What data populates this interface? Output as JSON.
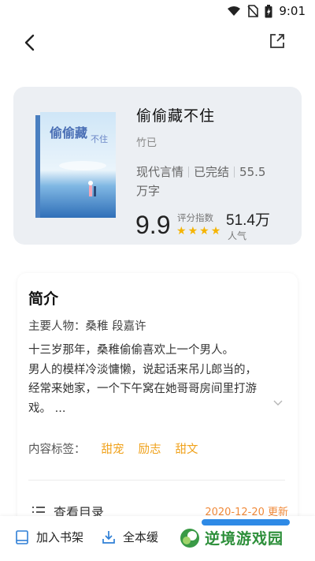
{
  "status_bar": {
    "time": "9:01",
    "icons": [
      "wifi-icon",
      "no-sim-icon",
      "battery-icon"
    ]
  },
  "top_bar": {
    "back_icon": "back-arrow-icon",
    "share_icon": "share-icon"
  },
  "book": {
    "title": "偷偷藏不住",
    "author": "竹已",
    "genre": "现代言情",
    "status": "已完结",
    "word_count_num": "55.5",
    "word_count_unit": "万字",
    "score": "9.9",
    "score_label": "评分指数",
    "stars": 4,
    "popularity": "51.4万",
    "popularity_unit": "万",
    "popularity_num": "51.4",
    "popularity_label": "人气",
    "cover_text": "偷偷藏不住"
  },
  "intro": {
    "title": "简介",
    "characters": "主要人物：桑稚 段嘉许",
    "synopsis_lines": [
      "十三岁那年，桑稚偷偷喜欢上一个男人。",
      "男人的模样冷淡慵懒，说起话来吊儿郎当的，",
      "经常来她家，一个下午窝在她哥哥房间里打游",
      "戏。 ..."
    ],
    "tags_label": "内容标签：",
    "tags": [
      "甜宠",
      "励志",
      "甜文"
    ],
    "catalog_label": "查看目录",
    "catalog_update": "2020-12-20 更新"
  },
  "bottom_bar": {
    "add_shelf": "加入书架",
    "download_all": "全本缓",
    "watermark": "逆境游戏园"
  },
  "colors": {
    "accent_orange": "#f0a21c",
    "star": "#f5b400",
    "card_bg": "#eceff3",
    "read_button": "#2e8ae6",
    "watermark_green": "#2d8f3a"
  }
}
